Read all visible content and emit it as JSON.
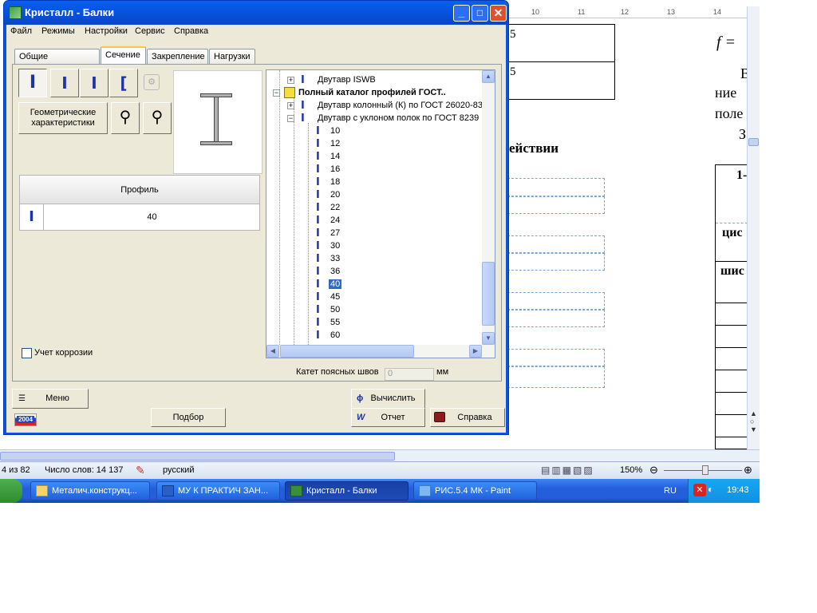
{
  "window": {
    "title": "Кристалл - Балки"
  },
  "menu": [
    "Файл",
    "Режимы",
    "Настройки",
    "Сервис",
    "Справка"
  ],
  "tabs": [
    "Общие параметры",
    "Сечение",
    "Закрепление",
    "Нагрузки"
  ],
  "section_panel": {
    "geom_button": "Геометрические характеристики",
    "grid_header": "Профиль",
    "grid_value": "40",
    "corrosion_label": "Учет коррозии",
    "corrosion_checked": false,
    "weld_label": "Катет поясных швов",
    "weld_value": "0",
    "weld_unit": "мм"
  },
  "tree": {
    "nodes": [
      {
        "label": "Двутавр ISWB",
        "bold": false
      },
      {
        "label": "Полный каталог профилей ГОСТ..",
        "bold": true
      },
      {
        "label": "Двутавр колонный (К) по ГОСТ 26020-83",
        "bold": false
      },
      {
        "label": "Двутавр с уклоном полок по ГОСТ 8239",
        "bold": false
      }
    ],
    "leaves": [
      "10",
      "12",
      "14",
      "16",
      "18",
      "20",
      "22",
      "24",
      "27",
      "30",
      "33",
      "36",
      "40",
      "45",
      "50",
      "55",
      "60"
    ],
    "selected": "40"
  },
  "buttons": {
    "menu": "Меню",
    "select": "Подбор",
    "calc": "Вычислить",
    "report": "Отчет",
    "help": "Справка",
    "logo": "2004"
  },
  "document": {
    "ruler": [
      "10",
      "11",
      "12",
      "13",
      "14"
    ],
    "cell1": "5",
    "cell2": "5",
    "heading": "ействии",
    "formula": "f =",
    "text1": "В",
    "text2": "ние",
    "text3": "поле",
    "text4": "З",
    "col1": "1-",
    "col2": "цис",
    "col3": "шис"
  },
  "statusbar": {
    "page": "4 из 82",
    "words": "Число слов: 14 137",
    "lang": "русский",
    "zoom": "150%"
  },
  "taskbar": {
    "items": [
      "Металич.конструкц...",
      "МУ К ПРАКТИЧ ЗАН...",
      "Кристалл - Балки",
      "РИС.5.4 МК - Paint"
    ],
    "active_index": 2,
    "lang": "RU",
    "clock": "19:43"
  }
}
